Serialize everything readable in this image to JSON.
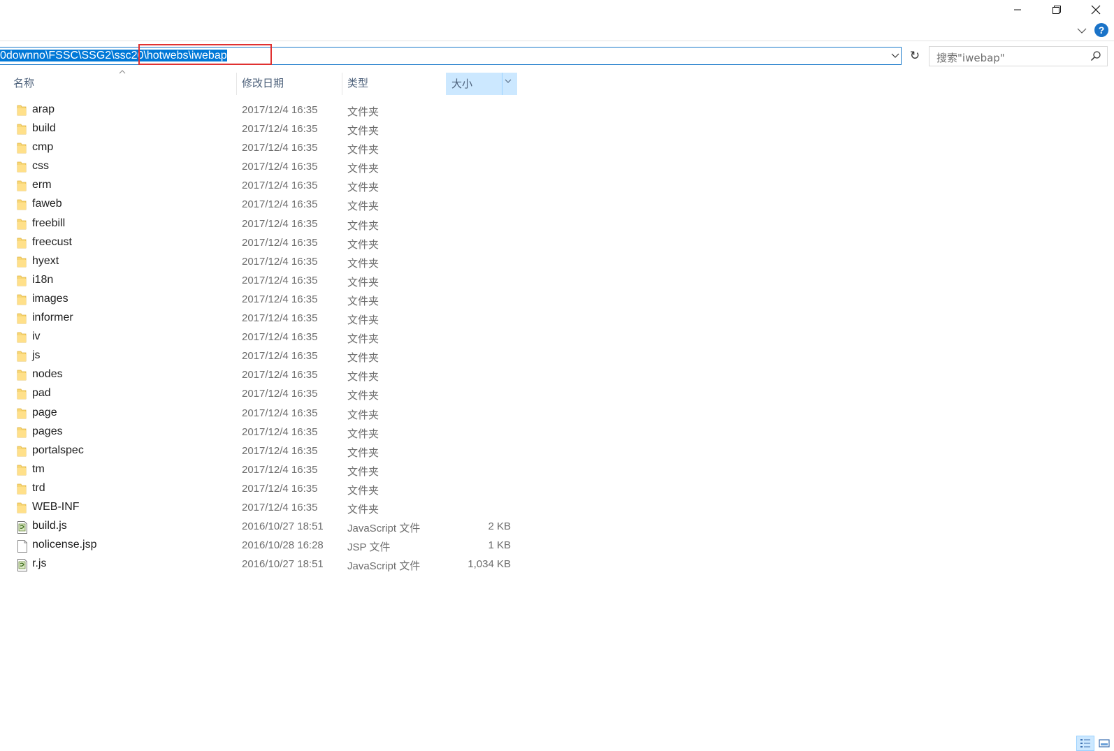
{
  "window": {
    "minimize": "minimize",
    "maximize": "restore",
    "close": "close"
  },
  "address": {
    "path_left": "0downno\\FSSC\\SSG2\\ssc20",
    "path_right": "\\hotwebs\\iwebap"
  },
  "search": {
    "placeholder": "搜索\"iwebap\""
  },
  "columns": {
    "name": "名称",
    "date": "修改日期",
    "type": "类型",
    "size": "大小"
  },
  "files": [
    {
      "name": "arap",
      "date": "2017/12/4 16:35",
      "type": "文件夹",
      "size": "",
      "icon": "folder-icon"
    },
    {
      "name": "build",
      "date": "2017/12/4 16:35",
      "type": "文件夹",
      "size": "",
      "icon": "folder-icon"
    },
    {
      "name": "cmp",
      "date": "2017/12/4 16:35",
      "type": "文件夹",
      "size": "",
      "icon": "folder-icon"
    },
    {
      "name": "css",
      "date": "2017/12/4 16:35",
      "type": "文件夹",
      "size": "",
      "icon": "folder-icon"
    },
    {
      "name": "erm",
      "date": "2017/12/4 16:35",
      "type": "文件夹",
      "size": "",
      "icon": "folder-icon"
    },
    {
      "name": "faweb",
      "date": "2017/12/4 16:35",
      "type": "文件夹",
      "size": "",
      "icon": "folder-icon"
    },
    {
      "name": "freebill",
      "date": "2017/12/4 16:35",
      "type": "文件夹",
      "size": "",
      "icon": "folder-icon"
    },
    {
      "name": "freecust",
      "date": "2017/12/4 16:35",
      "type": "文件夹",
      "size": "",
      "icon": "folder-icon"
    },
    {
      "name": "hyext",
      "date": "2017/12/4 16:35",
      "type": "文件夹",
      "size": "",
      "icon": "folder-icon"
    },
    {
      "name": "i18n",
      "date": "2017/12/4 16:35",
      "type": "文件夹",
      "size": "",
      "icon": "folder-icon"
    },
    {
      "name": "images",
      "date": "2017/12/4 16:35",
      "type": "文件夹",
      "size": "",
      "icon": "folder-icon"
    },
    {
      "name": "informer",
      "date": "2017/12/4 16:35",
      "type": "文件夹",
      "size": "",
      "icon": "folder-icon"
    },
    {
      "name": "iv",
      "date": "2017/12/4 16:35",
      "type": "文件夹",
      "size": "",
      "icon": "folder-icon"
    },
    {
      "name": "js",
      "date": "2017/12/4 16:35",
      "type": "文件夹",
      "size": "",
      "icon": "folder-icon"
    },
    {
      "name": "nodes",
      "date": "2017/12/4 16:35",
      "type": "文件夹",
      "size": "",
      "icon": "folder-icon"
    },
    {
      "name": "pad",
      "date": "2017/12/4 16:35",
      "type": "文件夹",
      "size": "",
      "icon": "folder-icon"
    },
    {
      "name": "page",
      "date": "2017/12/4 16:35",
      "type": "文件夹",
      "size": "",
      "icon": "folder-icon"
    },
    {
      "name": "pages",
      "date": "2017/12/4 16:35",
      "type": "文件夹",
      "size": "",
      "icon": "folder-icon"
    },
    {
      "name": "portalspec",
      "date": "2017/12/4 16:35",
      "type": "文件夹",
      "size": "",
      "icon": "folder-icon"
    },
    {
      "name": "tm",
      "date": "2017/12/4 16:35",
      "type": "文件夹",
      "size": "",
      "icon": "folder-icon"
    },
    {
      "name": "trd",
      "date": "2017/12/4 16:35",
      "type": "文件夹",
      "size": "",
      "icon": "folder-icon"
    },
    {
      "name": "WEB-INF",
      "date": "2017/12/4 16:35",
      "type": "文件夹",
      "size": "",
      "icon": "folder-icon"
    },
    {
      "name": "build.js",
      "date": "2016/10/27 18:51",
      "type": "JavaScript 文件",
      "size": "2 KB",
      "icon": "javascript-file-icon"
    },
    {
      "name": "nolicense.jsp",
      "date": "2016/10/28 16:28",
      "type": "JSP 文件",
      "size": "1 KB",
      "icon": "blank-file-icon"
    },
    {
      "name": "r.js",
      "date": "2016/10/27 18:51",
      "type": "JavaScript 文件",
      "size": "1,034 KB",
      "icon": "javascript-file-icon"
    }
  ],
  "colors": {
    "selection": "#0078d7",
    "address_border": "#1979ca",
    "highlight_box": "#e03131",
    "header_active": "#cce8ff",
    "folder": "#f8d775",
    "help": "#1a73c8"
  },
  "icons": {
    "help": "?",
    "refresh": "↻"
  }
}
